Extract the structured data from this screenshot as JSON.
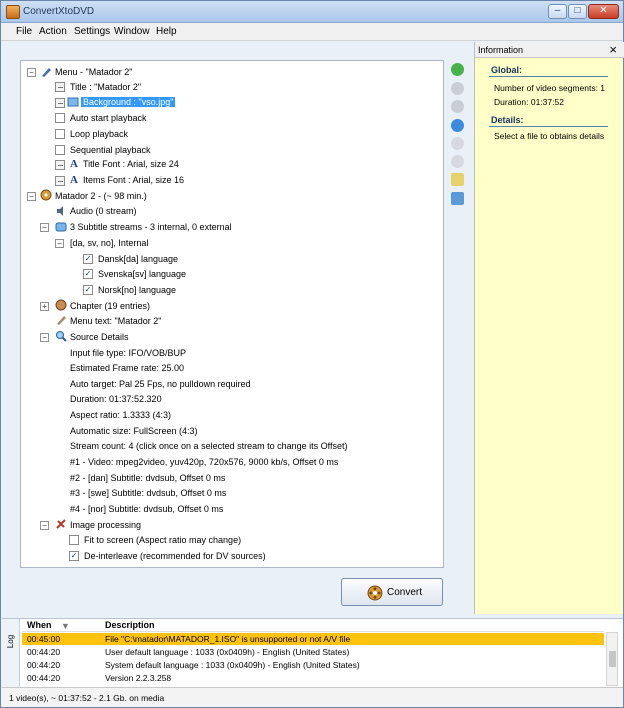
{
  "window": {
    "title": "ConvertXtoDVD",
    "minimize": "–",
    "maximize": "□",
    "close": "✕"
  },
  "menubar": {
    "items": [
      "File",
      "Action",
      "Settings",
      "Window",
      "Help"
    ]
  },
  "tree": {
    "menu_root": "Menu - \"Matador 2\"",
    "title": "Title : \"Matador 2\"",
    "background": "Background : \"vso.jpg\"",
    "auto_start": "Auto start playback",
    "loop": "Loop playback",
    "sequential": "Sequential playback",
    "title_font": "Title Font : Arial, size 24",
    "items_font": "Items Font : Arial, size 16",
    "title_root": "Matador 2 - (~ 98 min.)",
    "audio": "Audio (0 stream)",
    "subtitle_streams": "3 Subtitle streams - 3 internal, 0 external",
    "subtitle_group": "[da, sv, no], Internal",
    "danish": "Dansk[da] language",
    "swedish": "Svenska[sv] language",
    "norwegian": "Norsk[no] language",
    "chapter": "Chapter (19 entries)",
    "menu_text": "Menu text: \"Matador 2\"",
    "source_details": "Source Details",
    "input_type": "Input file type: IFO/VOB/BUP",
    "frame_rate": "Estimated Frame rate: 25.00",
    "auto_target": "Auto target: Pal 25 Fps, no pulldown required",
    "duration": "Duration: 01:37:52.320",
    "aspect": "Aspect ratio: 1.3333 (4:3)",
    "auto_size": "Automatic size: FullScreen (4:3)",
    "stream_count": "Stream count: 4 (click once on a selected stream to change its Offset)",
    "stream_1": "#1 - Video: mpeg2video, yuv420p, 720x576, 9000 kb/s, Offset 0 ms",
    "stream_2": "#2 - [dan] Subtitle: dvdsub, Offset 0 ms",
    "stream_3": "#3 - [swe] Subtitle: dvdsub, Offset 0 ms",
    "stream_4": "#4 - [nor] Subtitle: dvdsub, Offset 0 ms",
    "image_processing": "Image processing",
    "fit_screen": "Fit to screen (Aspect ratio may change)",
    "deinterleave": "De-interleave (recommended for DV sources)"
  },
  "info": {
    "header": "Information",
    "close": "×",
    "global_heading": "Global:",
    "segments": "Number of video segments: 1",
    "duration": "Duration: 01:37:52",
    "details_heading": "Details:",
    "details_text": "Select a file to obtains details"
  },
  "convert": {
    "label": "Convert"
  },
  "log": {
    "tab": "Log",
    "columns": {
      "when": "When",
      "description": "Description"
    },
    "rows": [
      {
        "when": "00:45:00",
        "description": "File \"C:\\matador\\MATADOR_1.ISO\" is unsupported or not A/V file"
      },
      {
        "when": "00:44:20",
        "description": "User default language : 1033 (0x0409h) - English (United States)"
      },
      {
        "when": "00:44:20",
        "description": "System default language : 1033 (0x0409h) - English (United States)"
      },
      {
        "when": "00:44:20",
        "description": "Version 2.2.3.258"
      }
    ]
  },
  "status": {
    "text": "1 video(s), ~ 01:37:52 - 2.1 Gb. on media"
  },
  "colors": {
    "selected_row": "#ffc20e",
    "selection_blue": "#3399ff",
    "info_background": "#ffffc8"
  }
}
